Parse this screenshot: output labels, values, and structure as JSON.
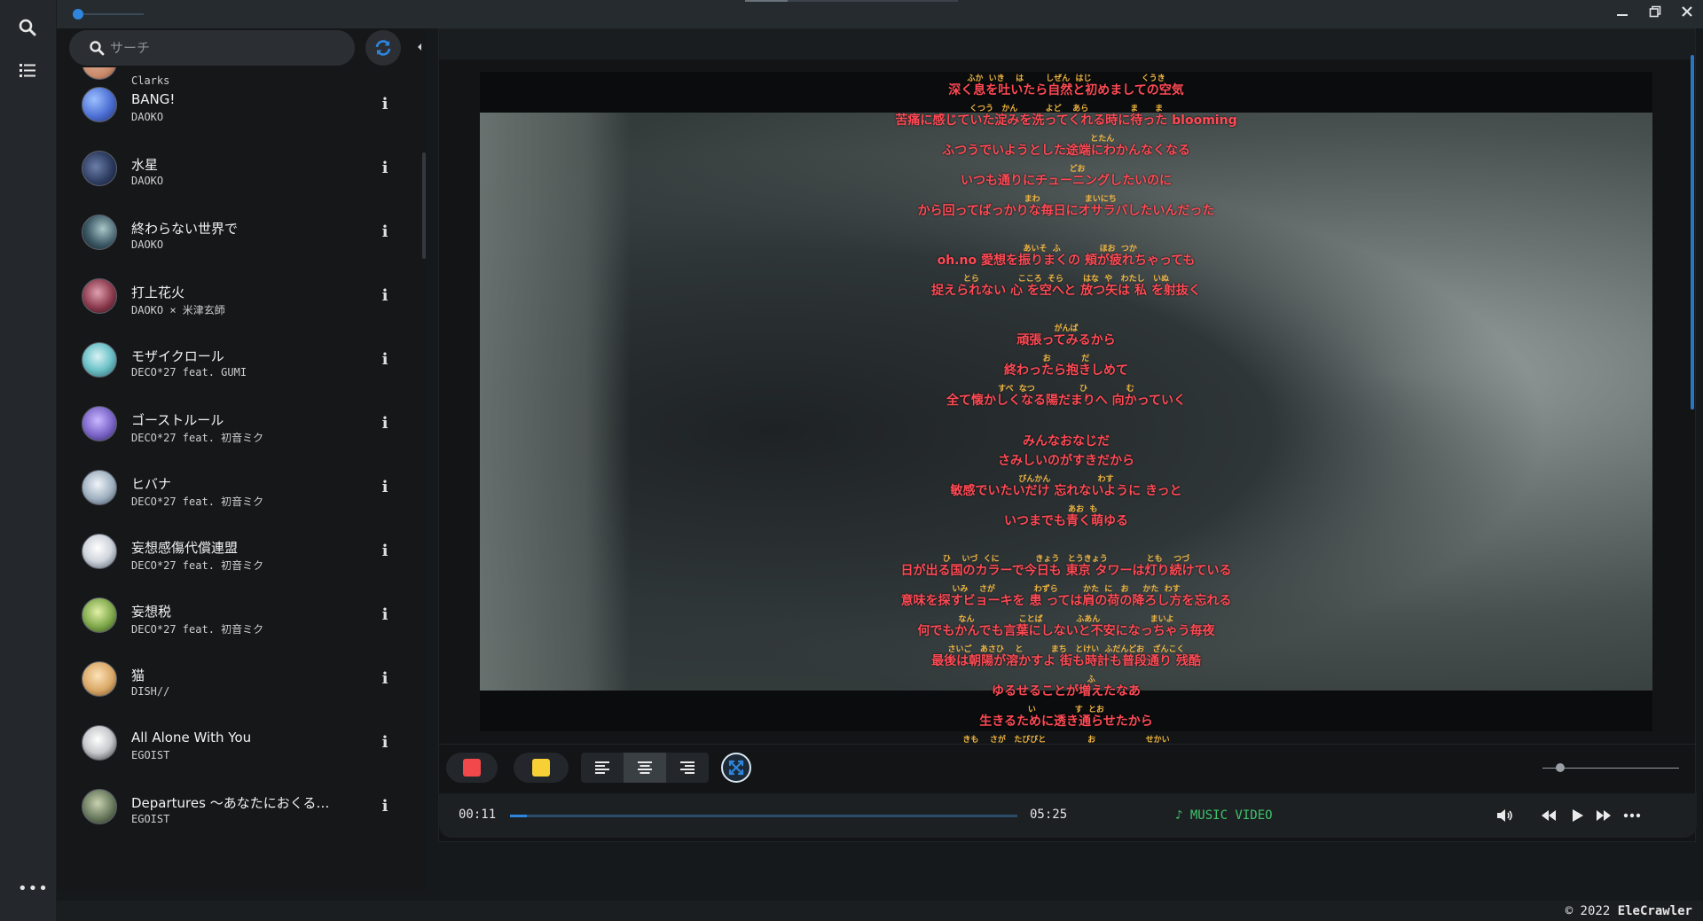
{
  "search": {
    "placeholder": "サーチ"
  },
  "songs": [
    {
      "title": "Clarks",
      "artist": "Clarks",
      "color": "#c98a6a"
    },
    {
      "title": "BANG!",
      "artist": "DAOKO",
      "color": "#4d6fd4"
    },
    {
      "title": "水星",
      "artist": "DAOKO",
      "color": "#2f3e63"
    },
    {
      "title": "終わらない世界で",
      "artist": "DAOKO",
      "color": "#3d5a66"
    },
    {
      "title": "打上花火",
      "artist": "DAOKO × 米津玄師",
      "color": "#8a3a4c"
    },
    {
      "title": "モザイクロール",
      "artist": "DECO*27 feat. GUMI",
      "color": "#6ec3c9"
    },
    {
      "title": "ゴーストルール",
      "artist": "DECO*27 feat. 初音ミク",
      "color": "#7b64c8"
    },
    {
      "title": "ヒバナ",
      "artist": "DECO*27 feat. 初音ミク",
      "color": "#9fb0c0"
    },
    {
      "title": "妄想感傷代償連盟",
      "artist": "DECO*27 feat. 初音ミク",
      "color": "#cfd4dc"
    },
    {
      "title": "妄想税",
      "artist": "DECO*27 feat. 初音ミク",
      "color": "#7fa84a"
    },
    {
      "title": "猫",
      "artist": "DISH//",
      "color": "#d9a866"
    },
    {
      "title": "All Alone With You",
      "artist": "EGOIST",
      "color": "#c7c9cc"
    },
    {
      "title": "Departures ～あなたにおくる…",
      "artist": "EGOIST",
      "color": "#6a7a5e"
    }
  ],
  "lyrics": [
    {
      "text": "深く息を吐いたら自然と初めましての空気",
      "furigana": "ふか  いき    は        しぜん  はじ                  くうき"
    },
    {
      "text": "苦痛に感じていた淀みを洗ってくれる時に待った blooming",
      "furigana": "くつう   かん          よど    あら               ま      ま"
    },
    {
      "text": "ふつうでいようとした途端にわかんなくなる",
      "furigana": "                          とたん"
    },
    {
      "text": "いつも通りにチューニングしたいのに",
      "furigana": "        どお"
    },
    {
      "text": "から回ってばっかりな毎日にオサラバしたいんだった",
      "furigana": "   まわ                まいにち"
    },
    {
      "text": "oh.no 愛想を振りまくの 頬が疲れちゃっても",
      "furigana": "          あいそ  ふ              ほお  つか"
    },
    {
      "text": "捉えられない 心 を空へと 放つ矢は 私 を射抜く",
      "furigana": "とら              こころ  そら       はな  や   わたし   いぬ"
    },
    {
      "text": "頑張ってみるから",
      "furigana": "がんば"
    },
    {
      "text": "終わったら抱きしめて",
      "furigana": "お           だ"
    },
    {
      "text": "全て懐かしくなる陽だまりへ 向かっていく",
      "furigana": "すべ  なつ                ひ              む"
    },
    {
      "text": "みんなおなじだ",
      "furigana": ""
    },
    {
      "text": "さみしいのがすきだから",
      "furigana": ""
    },
    {
      "text": "敏感でいたいだけ 忘れないように きっと",
      "furigana": "びんかん                 わす"
    },
    {
      "text": "いつまでも青く萌ゆる",
      "furigana": "            あお  も"
    },
    {
      "text": "日が出る国のカラーで今日も 東京 タワーは灯り続けている",
      "furigana": "ひ    いづ  くに             きょう   とうきょう              とも    つづ"
    },
    {
      "text": "意味を探すビョーキを 患 っては肩の荷の降ろし方を忘れる",
      "furigana": "いみ    さが              わずら         かた  に   お     かた  わす"
    },
    {
      "text": "何でもかんでも言葉にしないと不安になっちゃう毎夜",
      "furigana": "なん                ことば            ふあん                  まいよ"
    },
    {
      "text": "最後は朝陽が溶かすよ 街も時計も普段通り 残酷",
      "furigana": "さいご   あさひ    と          まち   とけい  ふだんどお   ざんこく"
    },
    {
      "text": "ゆるせることが増えたなあ",
      "furigana": "                  ふ"
    },
    {
      "text": "生きるために透き通らせたから",
      "furigana": "い              す  とお"
    },
    {
      "text": "",
      "furigana": "きも    さが   たびびと               お                  せかい"
    }
  ],
  "colors": {
    "lyric": "#ff4a55",
    "furigana": "#f0b540",
    "swatch_red": "#f2484b",
    "swatch_yellow": "#f7d036",
    "accent": "#2e86de",
    "mv": "#3ec46d"
  },
  "player": {
    "current_time": "00:11",
    "duration": "05:25",
    "progress": 0.034,
    "media_label": "♪ MUSIC VIDEO",
    "zoom_level": 0.13
  },
  "footer": {
    "copyright_prefix": "© 2022",
    "brand": "EleCrawler"
  },
  "icons": {
    "rail": [
      "search-icon",
      "list-icon",
      "more-icon"
    ],
    "toolbar": [
      "color-red",
      "color-yellow",
      "align-left-icon",
      "align-center-icon",
      "align-right-icon",
      "fullscreen-icon"
    ],
    "controls": [
      "volume-icon",
      "rewind-icon",
      "play-icon",
      "fast-forward-icon",
      "more-icon"
    ]
  }
}
